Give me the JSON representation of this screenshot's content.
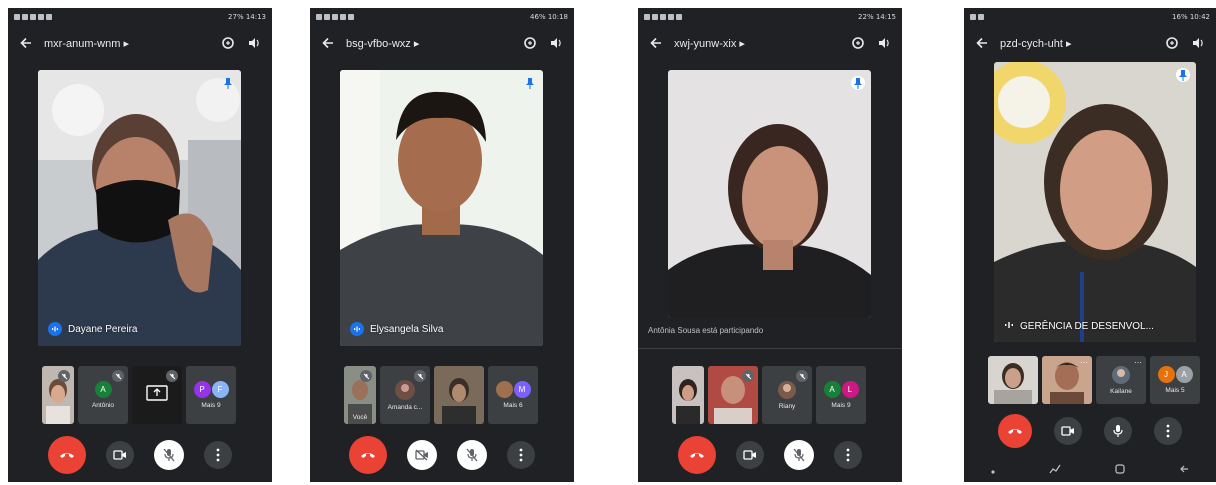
{
  "phones": [
    {
      "status_time": "27% 14:13",
      "meeting_code": "mxr-anum-wnm",
      "speaker_name": "Dayane Pereira",
      "thumbs": [
        {
          "label": ""
        },
        {
          "label": "Antônio",
          "avatar": "A",
          "color": "#188038"
        },
        {
          "label": ""
        },
        {
          "label": "Mais 9",
          "avatars": [
            "P",
            "F"
          ],
          "colors": [
            "#9334e6",
            "#8ab4f8"
          ]
        }
      ]
    },
    {
      "status_time": "46% 10:18",
      "meeting_code": "bsg-vfbo-wxz",
      "speaker_name": "Elysangela Silva",
      "thumbs": [
        {
          "label": "Você"
        },
        {
          "label": "Amanda c..."
        },
        {
          "label": ""
        },
        {
          "label": "Mais 6",
          "avatars": [
            "M"
          ],
          "colors": [
            "#7b61ff"
          ]
        }
      ]
    },
    {
      "status_time": "22% 14:15",
      "meeting_code": "xwj-yunw-xix",
      "participating_text": "Antônia Sousa está participando",
      "thumbs": [
        {
          "label": ""
        },
        {
          "label": ""
        },
        {
          "label": "Riany"
        },
        {
          "label": "Mais 9",
          "avatars": [
            "A",
            "L"
          ],
          "colors": [
            "#188038",
            "#d01884"
          ]
        }
      ]
    },
    {
      "status_time": "16% 10:42",
      "meeting_code": "pzd-cych-uht",
      "speaker_name": "GERÊNCIA DE DESENVOL...",
      "thumbs": [
        {
          "label": ""
        },
        {
          "label": ""
        },
        {
          "label": "Kailane"
        },
        {
          "label": "Mais 5",
          "avatars": [
            "J",
            "A"
          ],
          "colors": [
            "#e8710a",
            "#9aa0a6"
          ]
        }
      ]
    }
  ],
  "colors": {
    "end_call": "#ea4335",
    "bg": "#202124",
    "tile": "#3c4043",
    "speaking": "#1a73e8"
  }
}
